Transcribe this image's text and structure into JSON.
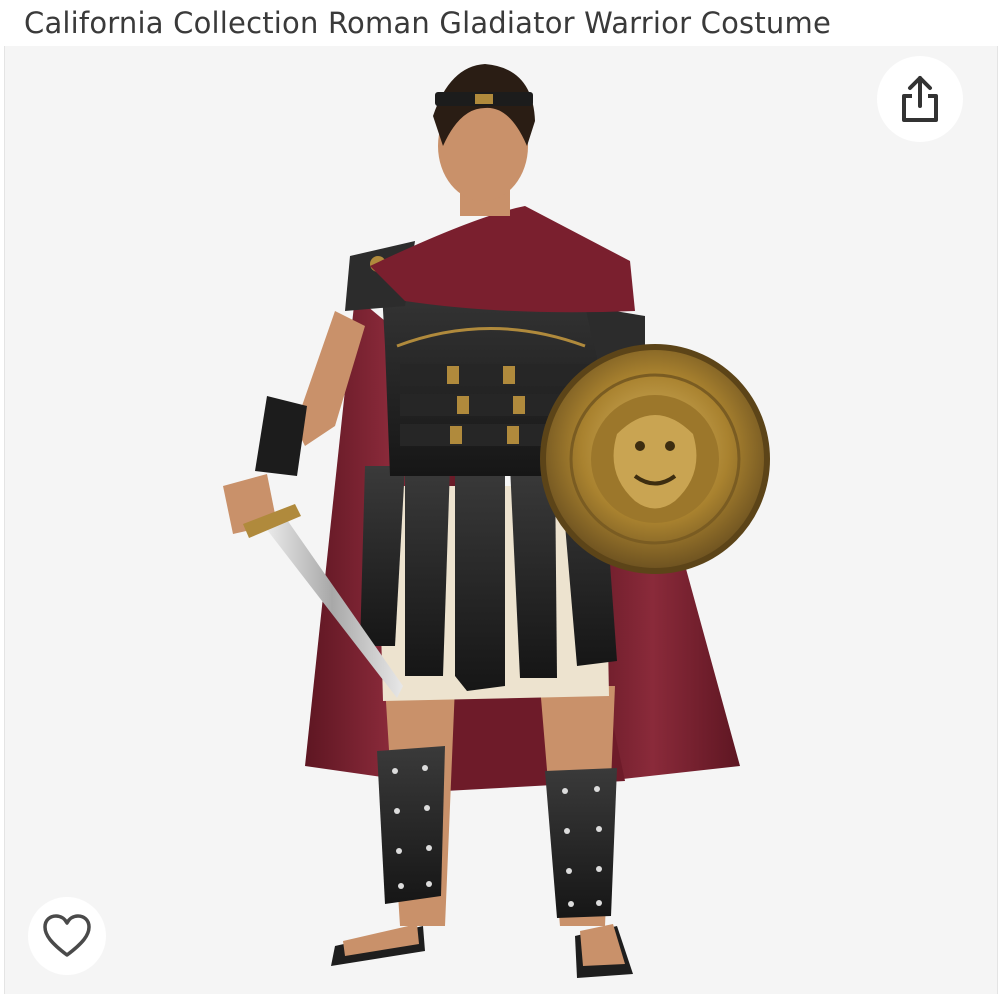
{
  "product": {
    "title": "California Collection Roman Gladiator Warrior Costume"
  },
  "image": {
    "subject": "gladiator-costume-model",
    "background_color": "#f5f5f5"
  },
  "share": {
    "icon": "share-icon"
  },
  "wishlist": {
    "icon": "heart-icon"
  },
  "colors": {
    "title_text": "#3a3a3a",
    "cape": "#7a1f2e",
    "armor": "#2a2a2a",
    "gold": "#b08a3c",
    "tunic": "#ede3cf"
  }
}
